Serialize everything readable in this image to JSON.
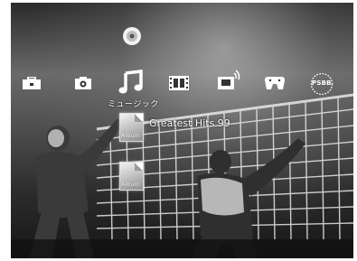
{
  "media_bar": {
    "categories": [
      {
        "name": "toolbox-icon"
      },
      {
        "name": "camera-icon"
      },
      {
        "name": "music-note-icon",
        "selected": true,
        "label": "ミュージック"
      },
      {
        "name": "film-strip-icon"
      },
      {
        "name": "tv-icon"
      },
      {
        "name": "gamepad-icon"
      },
      {
        "name": "network-icon",
        "text": "PSBB"
      }
    ],
    "selected_label": "ミュージック"
  },
  "disc": {
    "name": "disc-icon"
  },
  "items": [
    {
      "thumb_label": "Album",
      "title": "Greatest Hits 99"
    },
    {
      "thumb_label": "Album",
      "title": ""
    }
  ]
}
